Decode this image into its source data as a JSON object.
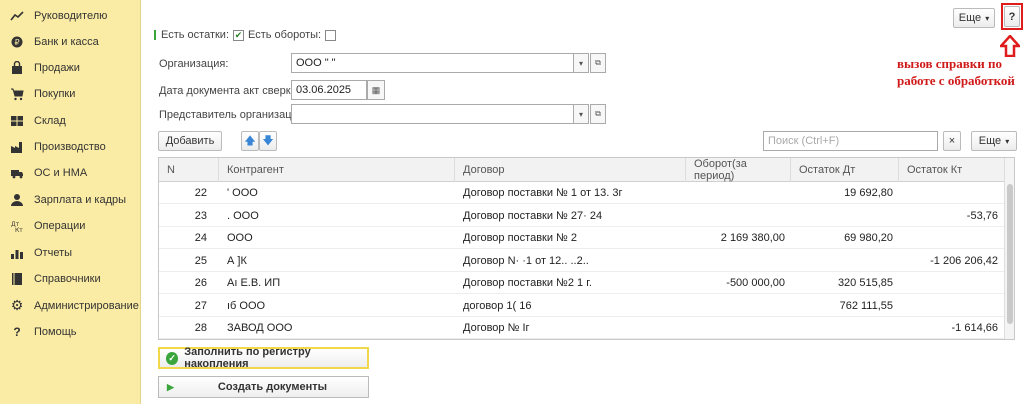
{
  "sidebar": {
    "items": [
      {
        "label": "Руководителю",
        "icon": "chart-line-icon"
      },
      {
        "label": "Банк и касса",
        "icon": "coin-icon"
      },
      {
        "label": "Продажи",
        "icon": "shopping-bag-icon"
      },
      {
        "label": "Покупки",
        "icon": "cart-icon"
      },
      {
        "label": "Склад",
        "icon": "warehouse-icon"
      },
      {
        "label": "Производство",
        "icon": "factory-icon"
      },
      {
        "label": "ОС и НМА",
        "icon": "truck-icon"
      },
      {
        "label": "Зарплата и кадры",
        "icon": "person-icon"
      },
      {
        "label": "Операции",
        "icon": "dt-kt-icon"
      },
      {
        "label": "Отчеты",
        "icon": "bar-chart-icon"
      },
      {
        "label": "Справочники",
        "icon": "book-icon"
      },
      {
        "label": "Администрирование",
        "icon": "gear-icon"
      },
      {
        "label": "Помощь",
        "icon": "question-icon"
      }
    ]
  },
  "toolbar": {
    "more_label": "Еще",
    "help_label": "?"
  },
  "flags": {
    "has_balances_label": "Есть остатки:",
    "has_turnover_label": "Есть обороты:"
  },
  "form": {
    "org_label": "Организация:",
    "org_value": "ООО \"                  \"",
    "date_label": "Дата документа акт сверки:",
    "date_value": "03.06.2025",
    "rep_label": "Представитель организации:",
    "rep_value": ""
  },
  "annotation": {
    "note": "вызов справки по работе с обработкой"
  },
  "table_toolbar": {
    "add_label": "Добавить",
    "search_placeholder": "Поиск (Ctrl+F)",
    "clear_label": "×",
    "more_label": "Еще"
  },
  "table": {
    "columns": [
      "N",
      "Контрагент",
      "Договор",
      "Оборот(за период)",
      "Остаток Дт",
      "Остаток Кт"
    ],
    "rows": [
      {
        "n": "22",
        "contractor": "'                       ООО",
        "contract": "Договор поставки № 1            от 13.         3г",
        "turnover": "",
        "debit": "19 692,80",
        "credit": ""
      },
      {
        "n": "23",
        "contractor": "           . ООО",
        "contract": "Договор поставки № 27·                         24",
        "turnover": "",
        "debit": "",
        "credit": "-53,76"
      },
      {
        "n": "24",
        "contractor": "           ООО",
        "contract": "Договор поставки № 2",
        "turnover": "2 169 380,00",
        "debit": "69 980,20",
        "credit": ""
      },
      {
        "n": "25",
        "contractor": "А                        ]К",
        "contract": "Договор N·          ·1 от 12.. ..2..",
        "turnover": "",
        "debit": "",
        "credit": "-1 206 206,42"
      },
      {
        "n": "26",
        "contractor": "Аı               Е.В. ИП",
        "contract": "Договор поставки №2                          1 г.",
        "turnover": "-500 000,00",
        "debit": "320 515,85",
        "credit": ""
      },
      {
        "n": "27",
        "contractor": "                      ıб ООО",
        "contract": " договор 1(                       16",
        "turnover": "",
        "debit": "762 111,55",
        "credit": ""
      },
      {
        "n": "28",
        "contractor": "                             ЗАВОД ООО",
        "contract": "Договор №                         Іг",
        "turnover": "",
        "debit": "",
        "credit": "-1 614,66"
      }
    ]
  },
  "actions": {
    "fill_label": "Заполнить по регистру накопления",
    "create_label": "Создать документы"
  },
  "colors": {
    "sidebar_bg": "#fbeca5",
    "accent_red": "#d01a1a",
    "accent_green": "#3aa53a",
    "arrow_blue": "#3a86d6"
  }
}
